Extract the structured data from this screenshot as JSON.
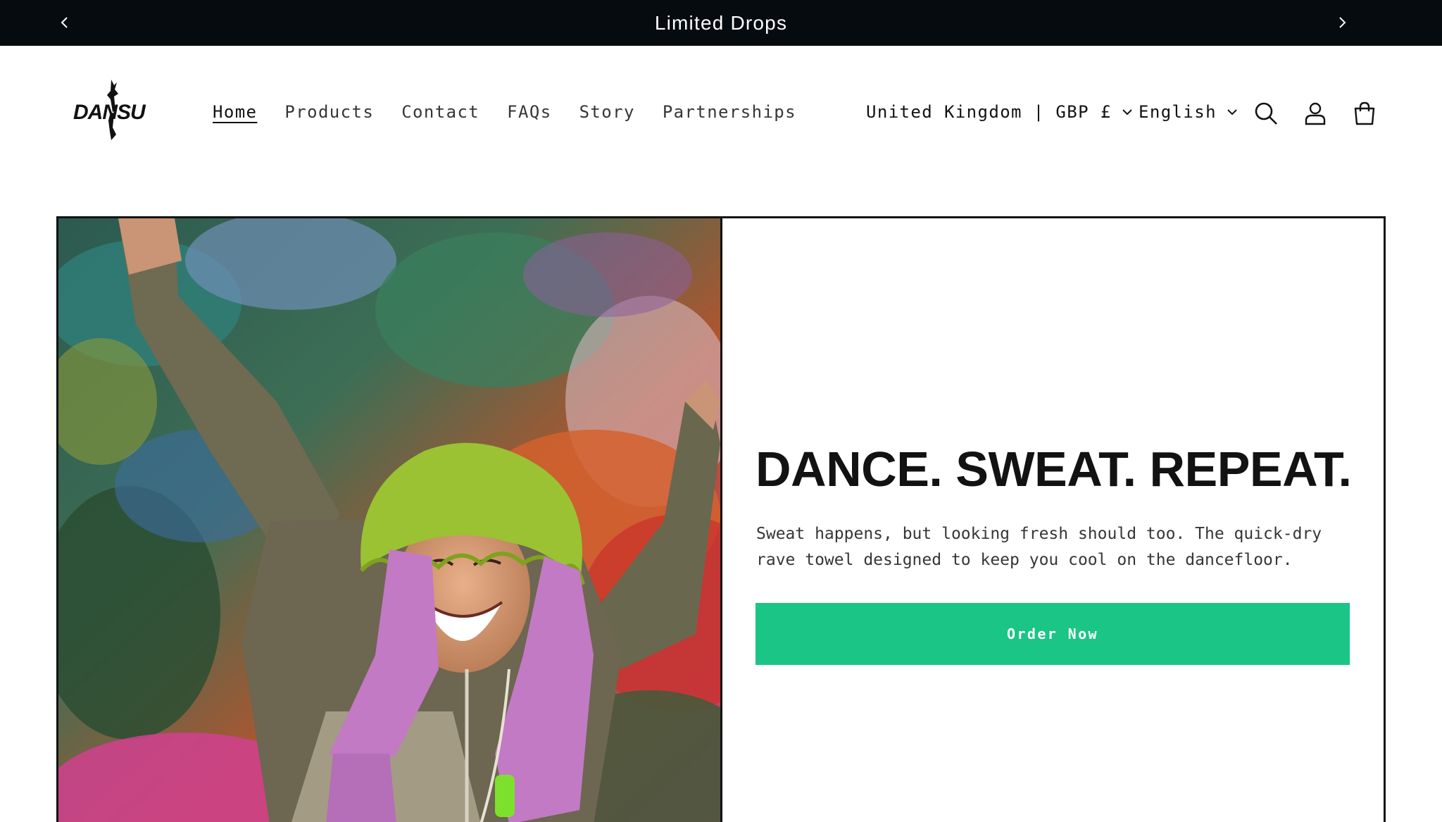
{
  "announcement": {
    "text": "Limited Drops",
    "prev_icon": "chevron-left-icon",
    "next_icon": "chevron-right-icon"
  },
  "header": {
    "logo_text": "DANSU",
    "nav": [
      {
        "label": "Home",
        "active": true
      },
      {
        "label": "Products",
        "active": false
      },
      {
        "label": "Contact",
        "active": false
      },
      {
        "label": "FAQs",
        "active": false
      },
      {
        "label": "Story",
        "active": false
      },
      {
        "label": "Partnerships",
        "active": false
      }
    ],
    "country_selector": "United Kingdom | GBP £",
    "language_selector": "English",
    "icons": [
      "search-icon",
      "account-icon",
      "cart-icon"
    ]
  },
  "hero": {
    "heading": "DANCE. SWEAT. REPEAT.",
    "text": "Sweat happens, but looking fresh should too. The quick-dry rave towel designed to keep you cool on the dancefloor.",
    "cta_label": "Order Now"
  },
  "colors": {
    "announcement_bg": "#060b10",
    "cta_bg": "#1ac586",
    "text": "#121212"
  }
}
